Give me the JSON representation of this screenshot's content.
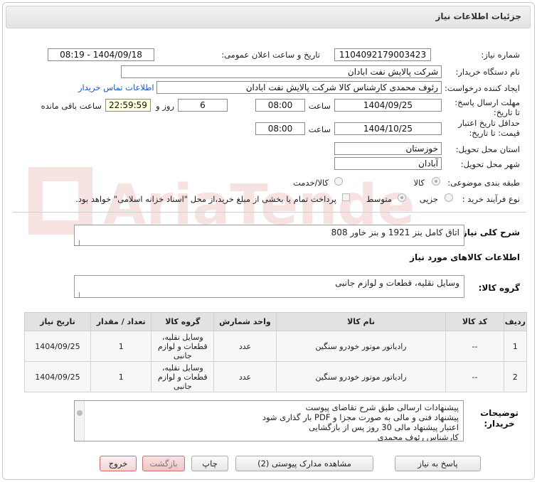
{
  "window": {
    "title": "جزئیات اطلاعات نیاز"
  },
  "labels": {
    "need_number": "شماره نیاز:",
    "announce_datetime": "تاریخ و ساعت اعلان عمومی:",
    "buyer_org": "نام دستگاه خریدار:",
    "requester": "ایجاد کننده درخواست:",
    "contact_link": "اطلاعات تماس خریدار",
    "reply_deadline": "مهلت ارسال پاسخ: تا تاریخ:",
    "time": "ساعت",
    "days_and": "روز و",
    "remaining": "ساعت باقی مانده",
    "price_validity": "حداقل تاریخ اعتبار قیمت: تا تاریخ:",
    "province": "استان محل تحویل:",
    "city": "شهر محل تحویل:",
    "category": "طبقه بندی موضوعی:",
    "purchase_type": "نوع فرآیند خرید :",
    "general_desc": "شرح کلی نیاز:",
    "goods_info": "اطلاعات کالاهای مورد نیاز",
    "goods_group": "گروه کالا:",
    "buyer_notes": "توضیحات خریدار:"
  },
  "values": {
    "need_number": "1104092179003423",
    "announce_datetime": "1404/09/18 - 08:19",
    "buyer_org": "شرکت پالایش نفت ابادان",
    "requester": "رئوف محمدی کارشناس کالا شرکت پالایش نفت ابادان",
    "reply_date": "1404/09/25",
    "reply_time": "08:00",
    "days": "6",
    "remaining_time": "22:59:59",
    "validity_date": "1404/10/25",
    "validity_time": "08:00",
    "province": "خوزستان",
    "city": "آبادان"
  },
  "category_options": [
    "کالا",
    "کالا/خدمت"
  ],
  "purchase_options": [
    "جزیی",
    "متوسط"
  ],
  "payment_note": "پرداخت تمام یا بخشی از مبلغ خرید،از محل \"اسناد خزانه اسلامی\" خواهد بود.",
  "general_desc": "اتاق کامل بنز 1921 و بنز خاور 808",
  "goods_group": "وسایل نقلیه، قطعات و لوازم جانبی",
  "table": {
    "headers": [
      "ردیف",
      "کد کالا",
      "نام کالا",
      "واحد شمارش",
      "گروه کالا",
      "تعداد / مقدار",
      "تاریخ نیاز"
    ],
    "rows": [
      [
        "1",
        "--",
        "رادیاتور موتور خودرو سنگین",
        "عدد",
        "وسایل نقلیه، قطعات و لوازم جانبی",
        "1",
        "1404/09/25"
      ],
      [
        "2",
        "--",
        "رادیاتور موتور خودرو سنگین",
        "عدد",
        "وسایل نقلیه، قطعات و لوازم جانبی",
        "1",
        "1404/09/25"
      ]
    ]
  },
  "notes": [
    "پیشنهادات ارسالی طبق شرح تقاضای پیوست",
    "پیشنهاد فنی و مالی به صورت مجزا و PDF بار گذاری شود",
    "اعتبار پیشنهاد مالی 30 روز پس از بازگشایی",
    "کارشناس رئوف  محمدی"
  ],
  "buttons": {
    "reply": "پاسخ به نیاز",
    "attachments": "مشاهده مدارک پیوستی (2)",
    "print": "چاپ",
    "back": "بازگشت",
    "exit": "خروج"
  },
  "watermark": "AriaTender.neT",
  "colors": {
    "link": "#1a56c4",
    "remaining_bg": "#ffffe0",
    "exit_border": "#d07070"
  }
}
